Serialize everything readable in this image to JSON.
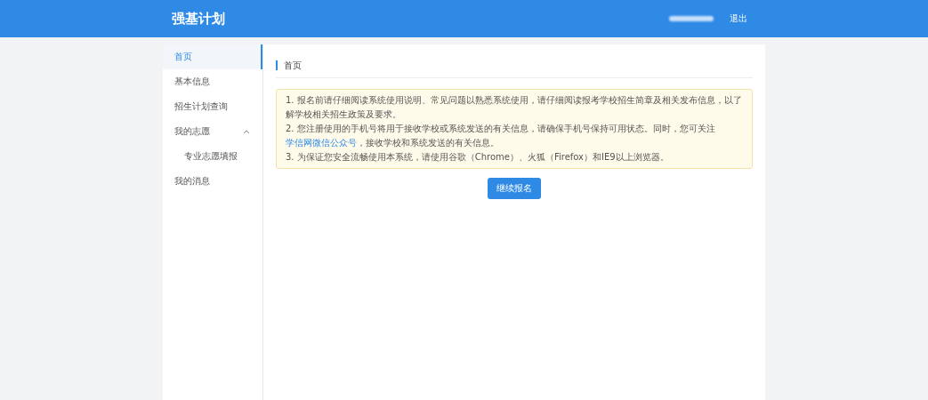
{
  "header": {
    "title": "强基计划",
    "logout": "退出"
  },
  "sidebar": {
    "items": [
      {
        "label": "首页",
        "selected": true
      },
      {
        "label": "基本信息",
        "selected": false
      },
      {
        "label": "招生计划查询",
        "selected": false
      },
      {
        "label": "我的志愿",
        "selected": false,
        "expanded": true,
        "children": [
          {
            "label": "专业志愿填报",
            "selected": false
          }
        ]
      },
      {
        "label": "我的消息",
        "selected": false
      }
    ]
  },
  "breadcrumb": "首页",
  "notice": [
    {
      "kind": "plain",
      "text": "1. 报名前请仔细阅读系统使用说明、常见问题以熟悉系统使用，请仔细阅读报考学校招生简章及相关发布信息，以了解学校相关招生政策及要求。"
    },
    {
      "kind": "link",
      "before": "2. 您注册使用的手机号将用于接收学校或系统发送的有关信息，请确保手机号保持可用状态。同时，您可关注",
      "link": "学信网微信公众号",
      "after": "，接收学校和系统发送的有关信息。"
    },
    {
      "kind": "plain",
      "text": "3. 为保证您安全流畅使用本系统，请使用谷歌（Chrome）、火狐（Firefox）和IE9以上浏览器。"
    }
  ],
  "continue_button": "继续报名"
}
